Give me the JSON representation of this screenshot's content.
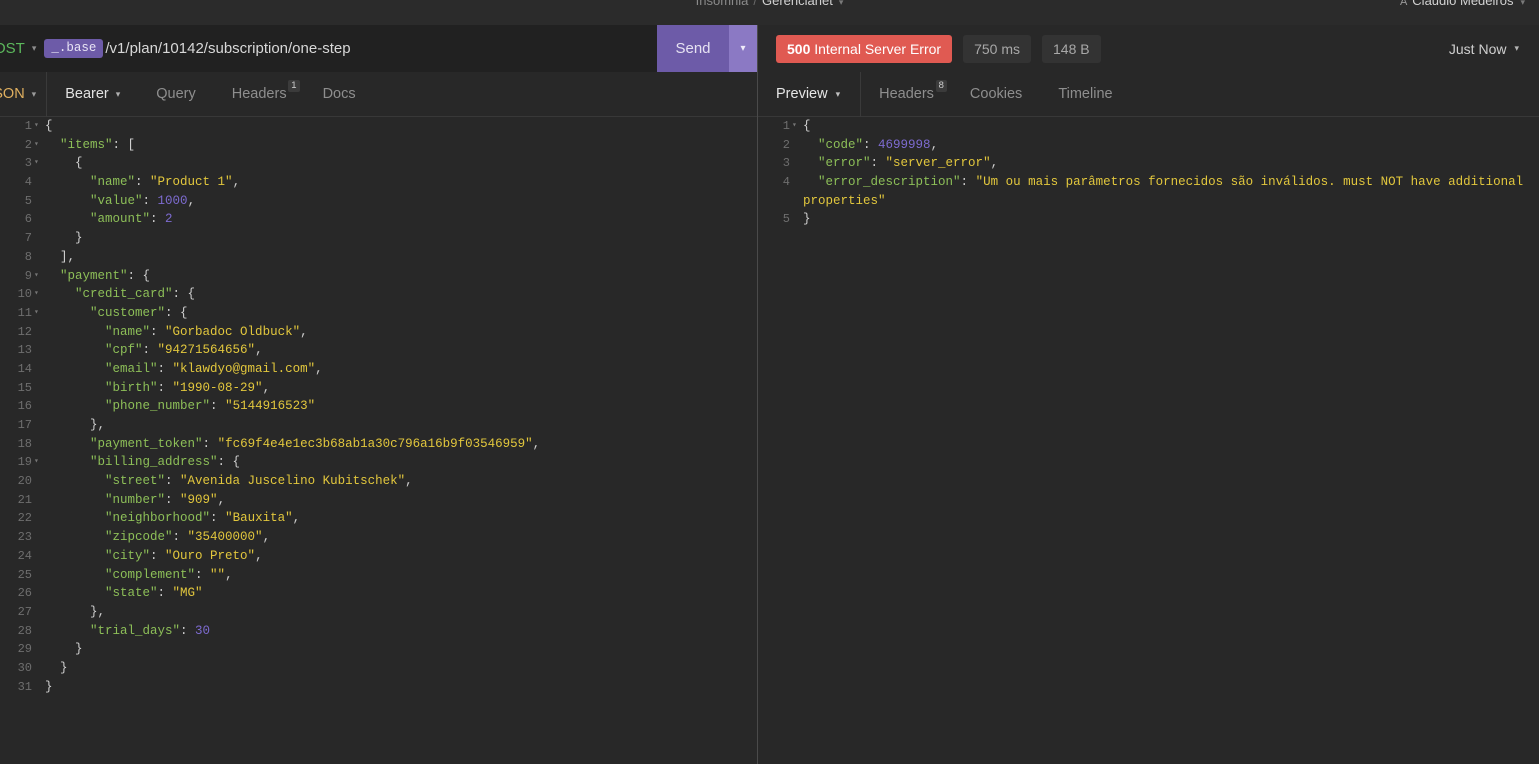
{
  "topbar": {
    "breadcrumb_root": "Insomnia",
    "breadcrumb_sep": "/",
    "breadcrumb_active": "Gerencianet",
    "breadcrumb_caret": "▾",
    "account_icon": "user-icon",
    "account_glyph": "A",
    "account_name": "Claudio Medeiros",
    "account_caret": "▾"
  },
  "request": {
    "method": "POST",
    "method_caret": "▾",
    "env_tag": "_.base",
    "url": "/v1/plan/10142/subscription/one-step",
    "send_label": "Send",
    "send_caret": "▾",
    "body_type": "JSON",
    "body_type_caret": "▾",
    "tabs": [
      {
        "label": "Bearer",
        "caret": "▾",
        "badge": "",
        "active": true
      },
      {
        "label": "Query",
        "caret": "",
        "badge": "",
        "active": false
      },
      {
        "label": "Headers",
        "caret": "",
        "badge": "1",
        "active": false
      },
      {
        "label": "Docs",
        "caret": "",
        "badge": "",
        "active": false
      }
    ],
    "body_lines": [
      {
        "n": "1",
        "fold": "▾",
        "tokens": [
          {
            "t": "{",
            "c": "p"
          }
        ]
      },
      {
        "n": "2",
        "fold": "▾",
        "tokens": [
          {
            "t": "  ",
            "c": "p"
          },
          {
            "t": "\"items\"",
            "c": "k"
          },
          {
            "t": ": [",
            "c": "p"
          }
        ]
      },
      {
        "n": "3",
        "fold": "▾",
        "tokens": [
          {
            "t": "    {",
            "c": "p"
          }
        ]
      },
      {
        "n": "4",
        "fold": "",
        "tokens": [
          {
            "t": "      ",
            "c": "p"
          },
          {
            "t": "\"name\"",
            "c": "k"
          },
          {
            "t": ": ",
            "c": "p"
          },
          {
            "t": "\"Product 1\"",
            "c": "s"
          },
          {
            "t": ",",
            "c": "p"
          }
        ]
      },
      {
        "n": "5",
        "fold": "",
        "tokens": [
          {
            "t": "      ",
            "c": "p"
          },
          {
            "t": "\"value\"",
            "c": "k"
          },
          {
            "t": ": ",
            "c": "p"
          },
          {
            "t": "1000",
            "c": "n"
          },
          {
            "t": ",",
            "c": "p"
          }
        ]
      },
      {
        "n": "6",
        "fold": "",
        "tokens": [
          {
            "t": "      ",
            "c": "p"
          },
          {
            "t": "\"amount\"",
            "c": "k"
          },
          {
            "t": ": ",
            "c": "p"
          },
          {
            "t": "2",
            "c": "n"
          }
        ]
      },
      {
        "n": "7",
        "fold": "",
        "tokens": [
          {
            "t": "    }",
            "c": "p"
          }
        ]
      },
      {
        "n": "8",
        "fold": "",
        "tokens": [
          {
            "t": "  ],",
            "c": "p"
          }
        ]
      },
      {
        "n": "9",
        "fold": "▾",
        "tokens": [
          {
            "t": "  ",
            "c": "p"
          },
          {
            "t": "\"payment\"",
            "c": "k"
          },
          {
            "t": ": {",
            "c": "p"
          }
        ]
      },
      {
        "n": "10",
        "fold": "▾",
        "tokens": [
          {
            "t": "    ",
            "c": "p"
          },
          {
            "t": "\"credit_card\"",
            "c": "k"
          },
          {
            "t": ": {",
            "c": "p"
          }
        ]
      },
      {
        "n": "11",
        "fold": "▾",
        "tokens": [
          {
            "t": "      ",
            "c": "p"
          },
          {
            "t": "\"customer\"",
            "c": "k"
          },
          {
            "t": ": {",
            "c": "p"
          }
        ]
      },
      {
        "n": "12",
        "fold": "",
        "tokens": [
          {
            "t": "        ",
            "c": "p"
          },
          {
            "t": "\"name\"",
            "c": "k"
          },
          {
            "t": ": ",
            "c": "p"
          },
          {
            "t": "\"Gorbadoc Oldbuck\"",
            "c": "s"
          },
          {
            "t": ",",
            "c": "p"
          }
        ]
      },
      {
        "n": "13",
        "fold": "",
        "tokens": [
          {
            "t": "        ",
            "c": "p"
          },
          {
            "t": "\"cpf\"",
            "c": "k"
          },
          {
            "t": ": ",
            "c": "p"
          },
          {
            "t": "\"94271564656\"",
            "c": "s"
          },
          {
            "t": ",",
            "c": "p"
          }
        ]
      },
      {
        "n": "14",
        "fold": "",
        "tokens": [
          {
            "t": "        ",
            "c": "p"
          },
          {
            "t": "\"email\"",
            "c": "k"
          },
          {
            "t": ": ",
            "c": "p"
          },
          {
            "t": "\"klawdyo@gmail.com\"",
            "c": "s"
          },
          {
            "t": ",",
            "c": "p"
          }
        ]
      },
      {
        "n": "15",
        "fold": "",
        "tokens": [
          {
            "t": "        ",
            "c": "p"
          },
          {
            "t": "\"birth\"",
            "c": "k"
          },
          {
            "t": ": ",
            "c": "p"
          },
          {
            "t": "\"1990-08-29\"",
            "c": "s"
          },
          {
            "t": ",",
            "c": "p"
          }
        ]
      },
      {
        "n": "16",
        "fold": "",
        "tokens": [
          {
            "t": "        ",
            "c": "p"
          },
          {
            "t": "\"phone_number\"",
            "c": "k"
          },
          {
            "t": ": ",
            "c": "p"
          },
          {
            "t": "\"5144916523\"",
            "c": "s"
          }
        ]
      },
      {
        "n": "17",
        "fold": "",
        "tokens": [
          {
            "t": "      },",
            "c": "p"
          }
        ]
      },
      {
        "n": "18",
        "fold": "",
        "tokens": [
          {
            "t": "      ",
            "c": "p"
          },
          {
            "t": "\"payment_token\"",
            "c": "k"
          },
          {
            "t": ": ",
            "c": "p"
          },
          {
            "t": "\"fc69f4e4e1ec3b68ab1a30c796a16b9f03546959\"",
            "c": "s"
          },
          {
            "t": ",",
            "c": "p"
          }
        ]
      },
      {
        "n": "19",
        "fold": "▾",
        "tokens": [
          {
            "t": "      ",
            "c": "p"
          },
          {
            "t": "\"billing_address\"",
            "c": "k"
          },
          {
            "t": ": {",
            "c": "p"
          }
        ]
      },
      {
        "n": "20",
        "fold": "",
        "tokens": [
          {
            "t": "        ",
            "c": "p"
          },
          {
            "t": "\"street\"",
            "c": "k"
          },
          {
            "t": ": ",
            "c": "p"
          },
          {
            "t": "\"Avenida Juscelino Kubitschek\"",
            "c": "s"
          },
          {
            "t": ",",
            "c": "p"
          }
        ]
      },
      {
        "n": "21",
        "fold": "",
        "tokens": [
          {
            "t": "        ",
            "c": "p"
          },
          {
            "t": "\"number\"",
            "c": "k"
          },
          {
            "t": ": ",
            "c": "p"
          },
          {
            "t": "\"909\"",
            "c": "s"
          },
          {
            "t": ",",
            "c": "p"
          }
        ]
      },
      {
        "n": "22",
        "fold": "",
        "tokens": [
          {
            "t": "        ",
            "c": "p"
          },
          {
            "t": "\"neighborhood\"",
            "c": "k"
          },
          {
            "t": ": ",
            "c": "p"
          },
          {
            "t": "\"Bauxita\"",
            "c": "s"
          },
          {
            "t": ",",
            "c": "p"
          }
        ]
      },
      {
        "n": "23",
        "fold": "",
        "tokens": [
          {
            "t": "        ",
            "c": "p"
          },
          {
            "t": "\"zipcode\"",
            "c": "k"
          },
          {
            "t": ": ",
            "c": "p"
          },
          {
            "t": "\"35400000\"",
            "c": "s"
          },
          {
            "t": ",",
            "c": "p"
          }
        ]
      },
      {
        "n": "24",
        "fold": "",
        "tokens": [
          {
            "t": "        ",
            "c": "p"
          },
          {
            "t": "\"city\"",
            "c": "k"
          },
          {
            "t": ": ",
            "c": "p"
          },
          {
            "t": "\"Ouro Preto\"",
            "c": "s"
          },
          {
            "t": ",",
            "c": "p"
          }
        ]
      },
      {
        "n": "25",
        "fold": "",
        "tokens": [
          {
            "t": "        ",
            "c": "p"
          },
          {
            "t": "\"complement\"",
            "c": "k"
          },
          {
            "t": ": ",
            "c": "p"
          },
          {
            "t": "\"\"",
            "c": "s"
          },
          {
            "t": ",",
            "c": "p"
          }
        ]
      },
      {
        "n": "26",
        "fold": "",
        "tokens": [
          {
            "t": "        ",
            "c": "p"
          },
          {
            "t": "\"state\"",
            "c": "k"
          },
          {
            "t": ": ",
            "c": "p"
          },
          {
            "t": "\"MG\"",
            "c": "s"
          }
        ]
      },
      {
        "n": "27",
        "fold": "",
        "tokens": [
          {
            "t": "      },",
            "c": "p"
          }
        ]
      },
      {
        "n": "28",
        "fold": "",
        "tokens": [
          {
            "t": "      ",
            "c": "p"
          },
          {
            "t": "\"trial_days\"",
            "c": "k"
          },
          {
            "t": ": ",
            "c": "p"
          },
          {
            "t": "30",
            "c": "n"
          }
        ]
      },
      {
        "n": "29",
        "fold": "",
        "tokens": [
          {
            "t": "    }",
            "c": "p"
          }
        ]
      },
      {
        "n": "30",
        "fold": "",
        "tokens": [
          {
            "t": "  }",
            "c": "p"
          }
        ]
      },
      {
        "n": "31",
        "fold": "",
        "tokens": [
          {
            "t": "}",
            "c": "p"
          }
        ]
      }
    ]
  },
  "response": {
    "status_code": "500",
    "status_text": "Internal Server Error",
    "time": "750 ms",
    "size": "148 B",
    "history_label": "Just Now",
    "history_caret": "▾",
    "preview_label": "Preview",
    "preview_caret": "▾",
    "tabs": [
      {
        "label": "Headers",
        "badge": "8"
      },
      {
        "label": "Cookies",
        "badge": ""
      },
      {
        "label": "Timeline",
        "badge": ""
      }
    ],
    "body_lines": [
      {
        "n": "1",
        "fold": "▾",
        "tokens": [
          {
            "t": "{",
            "c": "p"
          }
        ]
      },
      {
        "n": "2",
        "fold": "",
        "tokens": [
          {
            "t": "  ",
            "c": "p"
          },
          {
            "t": "\"code\"",
            "c": "k"
          },
          {
            "t": ": ",
            "c": "p"
          },
          {
            "t": "4699998",
            "c": "n"
          },
          {
            "t": ",",
            "c": "p"
          }
        ]
      },
      {
        "n": "3",
        "fold": "",
        "tokens": [
          {
            "t": "  ",
            "c": "p"
          },
          {
            "t": "\"error\"",
            "c": "k"
          },
          {
            "t": ": ",
            "c": "p"
          },
          {
            "t": "\"server_error\"",
            "c": "s"
          },
          {
            "t": ",",
            "c": "p"
          }
        ]
      },
      {
        "n": "4",
        "fold": "",
        "wrap": true,
        "tokens": [
          {
            "t": "  ",
            "c": "p"
          },
          {
            "t": "\"error_description\"",
            "c": "k"
          },
          {
            "t": ": ",
            "c": "p"
          },
          {
            "t": "\"Um ou mais parâmetros fornecidos são inválidos. must NOT have additional properties\"",
            "c": "s"
          }
        ]
      },
      {
        "n": "5",
        "fold": "",
        "tokens": [
          {
            "t": "}",
            "c": "p"
          }
        ]
      }
    ]
  },
  "colors": {
    "background": "#282828",
    "url_bar_bg": "#212121",
    "accent_purple": "#6d5ba8",
    "accent_purple_light": "#8b79c4",
    "error_red": "#e05a52",
    "method_green": "#5cb85c",
    "json_key_green": "#8dbf58",
    "json_string_yellow": "#e2c73d",
    "json_number_purple": "#7d6bd0"
  }
}
